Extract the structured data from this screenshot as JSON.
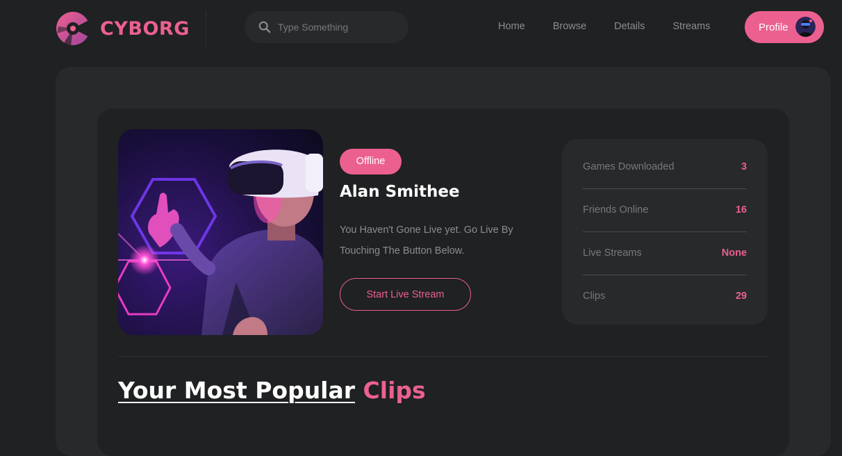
{
  "brand": {
    "name": "CYBORG",
    "accent": "#ec6090"
  },
  "search": {
    "placeholder": "Type Something",
    "value": ""
  },
  "nav": {
    "items": [
      "Home",
      "Browse",
      "Details",
      "Streams"
    ]
  },
  "profile_button": {
    "label": "Profile"
  },
  "profile": {
    "status": "Offline",
    "name": "Alan Smithee",
    "description": "You Haven't Gone Live yet. Go Live By Touching The Button Below.",
    "cta_label": "Start Live Stream"
  },
  "stats": [
    {
      "label": "Games Downloaded",
      "value": "3"
    },
    {
      "label": "Friends Online",
      "value": "16"
    },
    {
      "label": "Live Streams",
      "value": "None"
    },
    {
      "label": "Clips",
      "value": "29"
    }
  ],
  "section": {
    "title_main": "Your Most Popular",
    "title_accent": "Clips"
  }
}
